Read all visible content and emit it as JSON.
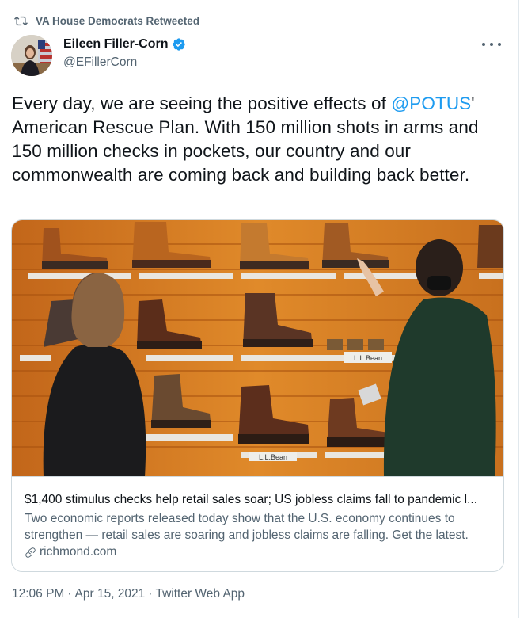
{
  "retweet": {
    "icon": "retweet-icon",
    "label": "VA House Democrats Retweeted"
  },
  "author": {
    "name": "Eileen Filler-Corn",
    "handle": "@EFillerCorn",
    "verified_icon": "verified-badge-icon"
  },
  "more_icon": "more-options-icon",
  "tweet": {
    "part1": "Every day, we are seeing the positive effects of ",
    "mention": "@POTUS",
    "part2": "' American Rescue Plan. With 150 million shots in arms and 150 million checks in pockets, our country and our commonwealth are coming back and building back better."
  },
  "card": {
    "title": "$1,400 stimulus checks help retail sales soar; US jobless claims fall to pandemic l...",
    "description": "Two economic reports released today show that the U.S. economy continues to strengthen — retail sales are soaring and jobless claims are falling. Get the latest.",
    "domain": "richmond.com",
    "link_icon": "link-icon",
    "image_signs": [
      "L.L.Bean",
      "L.L.Bean"
    ]
  },
  "meta": {
    "time": "12:06 PM",
    "date": "Apr 15, 2021",
    "source": "Twitter Web App",
    "separator": "·"
  },
  "colors": {
    "accent": "#1d9bf0",
    "secondary_text": "#536471",
    "border": "#cfd9de"
  }
}
